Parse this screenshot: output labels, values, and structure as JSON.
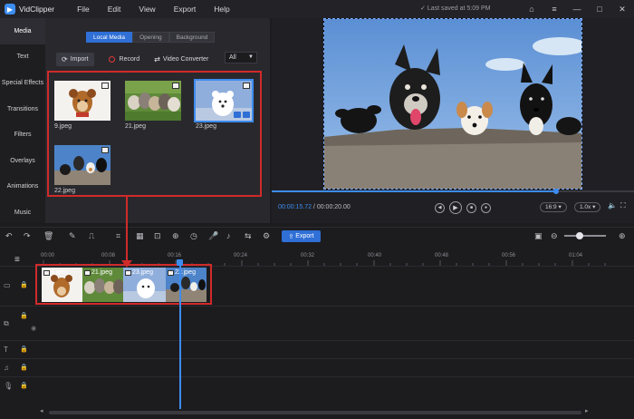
{
  "app": {
    "title": "VidClipper",
    "menu": [
      "File",
      "Edit",
      "View",
      "Export",
      "Help"
    ],
    "saved_status": "Last saved at 5:09 PM"
  },
  "nav": {
    "items": [
      {
        "label": "Media"
      },
      {
        "label": "Text"
      },
      {
        "label": "Special Effects"
      },
      {
        "label": "Transitions"
      },
      {
        "label": "Filters"
      },
      {
        "label": "Overlays"
      },
      {
        "label": "Animations"
      },
      {
        "label": "Music"
      }
    ]
  },
  "media": {
    "tabs": [
      "Local Media",
      "Opening",
      "Background"
    ],
    "import_label": "Import",
    "record_label": "Record",
    "converter_label": "Video Converter",
    "filter_value": "All",
    "files": [
      {
        "name": "9.jpeg"
      },
      {
        "name": "21.jpeg"
      },
      {
        "name": "23.jpeg"
      },
      {
        "name": "22.jpeg"
      }
    ]
  },
  "preview": {
    "current_time": "00:00:15.72",
    "separator": " / ",
    "total_time": "00:00:20.00",
    "progress": 0.786,
    "aspect_ratio": "16:9",
    "speed": "1.0x"
  },
  "timeline": {
    "export_label": "Export",
    "ruler": [
      "00:00",
      "00:08",
      "00:16",
      "00:24",
      "00:32",
      "00:40",
      "00:48",
      "00:56",
      "01:04"
    ],
    "clips": [
      {
        "label": "9.jpeg"
      },
      {
        "label": "21.jpeg"
      },
      {
        "label": "23.jpeg"
      },
      {
        "label": "22.jpeg"
      }
    ]
  },
  "colors": {
    "accent": "#3d8cf0",
    "highlight_red": "#d12a2a",
    "panel": "#29292d"
  }
}
